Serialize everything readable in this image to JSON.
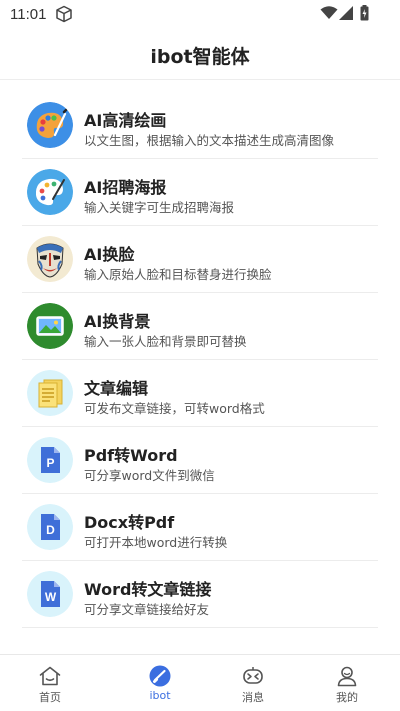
{
  "status_bar": {
    "time": "11:01"
  },
  "header": {
    "title": "ibot智能体"
  },
  "items": [
    {
      "title": "AI高清绘画",
      "desc": "以文生图，根据输入的文本描述生成高清图像",
      "icon": "palette-icon"
    },
    {
      "title": "AI招聘海报",
      "desc": "输入关键字可生成招聘海报",
      "icon": "paint-palette-icon"
    },
    {
      "title": "AI换脸",
      "desc": "输入原始人脸和目标替身进行换脸",
      "icon": "opera-mask-icon"
    },
    {
      "title": "AI换背景",
      "desc": "输入一张人脸和背景即可替换",
      "icon": "landscape-image-icon"
    },
    {
      "title": "文章编辑",
      "desc": "可发布文章链接，可转word格式",
      "icon": "document-icon"
    },
    {
      "title": "Pdf转Word",
      "desc": "可分享word文件到微信",
      "icon": "file-p-icon"
    },
    {
      "title": "Docx转Pdf",
      "desc": "可打开本地word进行转换",
      "icon": "file-d-icon"
    },
    {
      "title": "Word转文章链接",
      "desc": "可分享文章链接给好友",
      "icon": "file-w-icon"
    }
  ],
  "tabbar": {
    "tabs": [
      {
        "label": "首页",
        "icon": "home-icon"
      },
      {
        "label": "ibot",
        "icon": "ibot-icon",
        "active": true
      },
      {
        "label": "消息",
        "icon": "robot-message-icon"
      },
      {
        "label": "我的",
        "icon": "user-icon"
      }
    ]
  },
  "colors": {
    "accent": "#3b6ee0",
    "icon_bg": "#4aa8e8",
    "doc_blue": "#3f6fd8"
  }
}
